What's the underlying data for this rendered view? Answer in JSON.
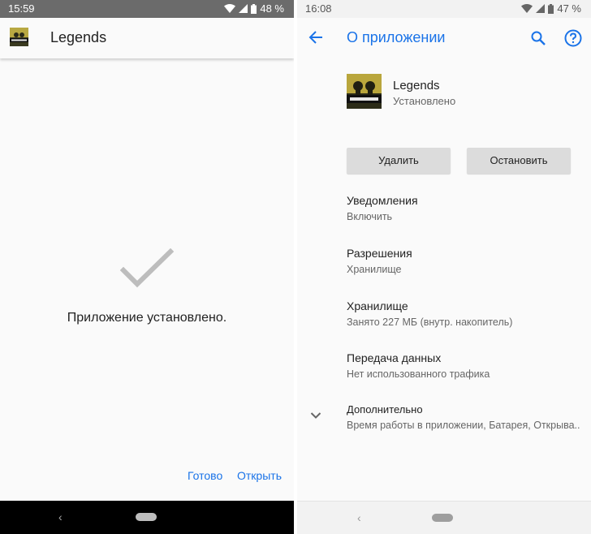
{
  "left": {
    "status": {
      "time": "15:59",
      "battery": "48 %"
    },
    "app_title": "Legends",
    "message": "Приложение установлено.",
    "actions": {
      "done": "Готово",
      "open": "Открыть"
    },
    "nav": {
      "back": "‹"
    }
  },
  "right": {
    "status": {
      "time": "16:08",
      "battery": "47 %"
    },
    "title": "О приложении",
    "app": {
      "name": "Legends",
      "status": "Установлено"
    },
    "buttons": {
      "uninstall": "Удалить",
      "force_stop": "Остановить"
    },
    "settings": [
      {
        "title": "Уведомления",
        "subtitle": "Включить"
      },
      {
        "title": "Разрешения",
        "subtitle": "Хранилище"
      },
      {
        "title": "Хранилище",
        "subtitle": "Занято 227 МБ (внутр. накопитель)"
      },
      {
        "title": "Передача данных",
        "subtitle": "Нет использованного трафика"
      },
      {
        "title": "Дополнительно",
        "subtitle": "Время работы в приложении, Батарея, Открыва.."
      }
    ],
    "nav": {
      "back": "‹"
    }
  },
  "icons": {
    "wifi": "wifi-icon",
    "signal": "signal-icon",
    "battery": "battery-icon",
    "back": "arrow-back-icon",
    "search": "search-icon",
    "help": "help-icon",
    "check": "checkmark-icon",
    "expand": "chevron-down-icon",
    "app": "call-of-duty-app-icon"
  },
  "colors": {
    "accent": "#1a73e8",
    "button_gray": "#dcdcdc",
    "left_statusbar": "#6b6b6b"
  }
}
